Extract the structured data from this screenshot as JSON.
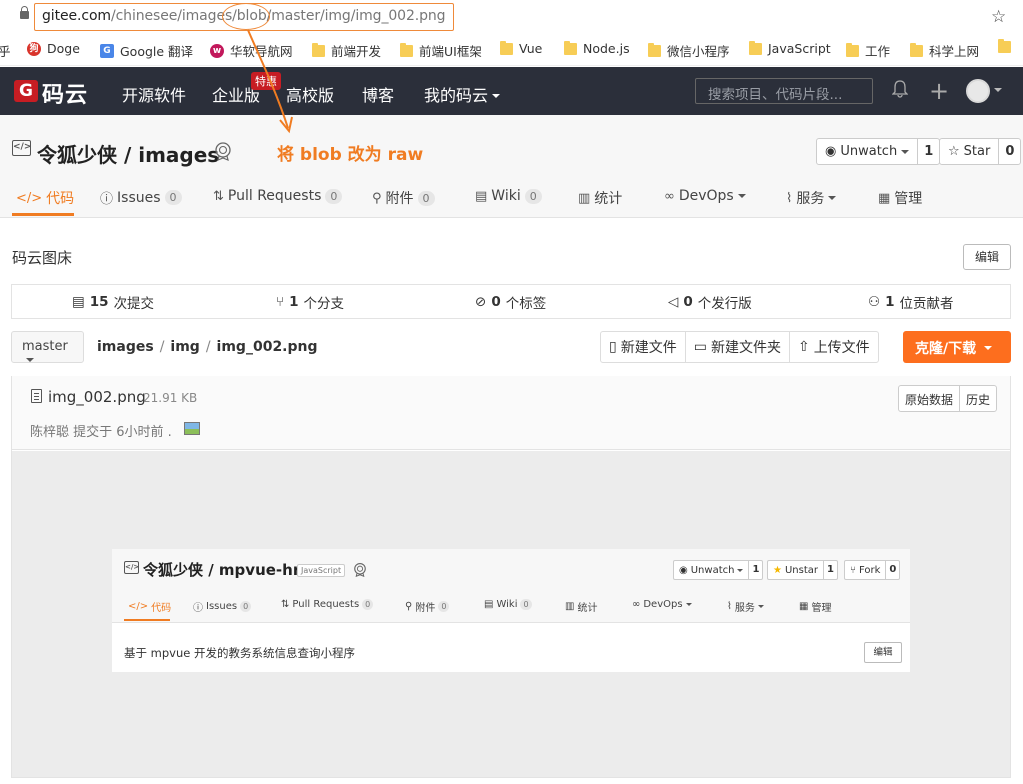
{
  "browser": {
    "url_host": "gitee.com",
    "url_path": "/chinesee/images/blob/master/img/img_002.png",
    "bookmarks": [
      {
        "label": "乎"
      },
      {
        "label": "Doge"
      },
      {
        "label": "Google 翻译"
      },
      {
        "label": "华软导航网"
      },
      {
        "label": "前端开发"
      },
      {
        "label": "前端UI框架"
      },
      {
        "label": "Vue"
      },
      {
        "label": "Node.js"
      },
      {
        "label": "微信小程序"
      },
      {
        "label": "JavaScript"
      },
      {
        "label": "工作"
      },
      {
        "label": "科学上网"
      }
    ]
  },
  "topnav": {
    "logo_letter": "G",
    "logo_text": "码云",
    "items": [
      "开源软件",
      "企业版",
      "高校版",
      "博客",
      "我的码云"
    ],
    "hot_badge": "特惠",
    "search_placeholder": "搜索项目、代码片段..."
  },
  "repo": {
    "title": "令狐少侠 / images",
    "annotation": "将 blob 改为 raw",
    "watch": {
      "label": "Unwatch",
      "count": "1"
    },
    "star": {
      "label": "Star",
      "count": "0"
    },
    "tabs": [
      {
        "label": "代码",
        "count": ""
      },
      {
        "label": "Issues",
        "count": "0"
      },
      {
        "label": "Pull Requests",
        "count": "0"
      },
      {
        "label": "附件",
        "count": "0"
      },
      {
        "label": "Wiki",
        "count": "0"
      },
      {
        "label": "统计",
        "count": ""
      },
      {
        "label": "DevOps",
        "count": ""
      },
      {
        "label": "服务",
        "count": ""
      },
      {
        "label": "管理",
        "count": ""
      }
    ],
    "description": "码云图床",
    "edit_label": "编辑",
    "stats": {
      "commits_num": "15",
      "commits_label": "次提交",
      "branches_num": "1",
      "branches_label": "个分支",
      "tags_num": "0",
      "tags_label": "个标签",
      "releases_num": "0",
      "releases_label": "个发行版",
      "contributors_num": "1",
      "contributors_label": "位贡献者"
    },
    "branch": "master",
    "breadcrumb": [
      "images",
      "img",
      "img_002.png"
    ],
    "actions": [
      "新建文件",
      "新建文件夹",
      "上传文件"
    ],
    "clone_label": "克隆/下载"
  },
  "file": {
    "name": "img_002.png",
    "size": "21.91 KB",
    "commit_info": "陈梓聪 提交于 6小时前 .",
    "raw_label": "原始数据",
    "history_label": "历史"
  },
  "preview": {
    "title": "令狐少侠 / mpvue-hr",
    "lang": "JavaScript",
    "watch": {
      "label": "Unwatch",
      "count": "1"
    },
    "unstar": {
      "label": "Unstar",
      "count": "1"
    },
    "fork": {
      "label": "Fork",
      "count": "0"
    },
    "tabs": [
      {
        "label": "代码",
        "count": ""
      },
      {
        "label": "Issues",
        "count": "0"
      },
      {
        "label": "Pull Requests",
        "count": "0"
      },
      {
        "label": "附件",
        "count": "0"
      },
      {
        "label": "Wiki",
        "count": "0"
      },
      {
        "label": "统计",
        "count": ""
      },
      {
        "label": "DevOps",
        "count": ""
      },
      {
        "label": "服务",
        "count": ""
      },
      {
        "label": "管理",
        "count": ""
      }
    ],
    "description": "基于 mpvue 开发的教务系统信息查询小程序",
    "edit_label": "编辑"
  },
  "colors": {
    "accent": "#f07c22",
    "brand_red": "#c71d23",
    "nav_bg": "#2b2f3a",
    "clone_btn": "#fd6e1e"
  }
}
